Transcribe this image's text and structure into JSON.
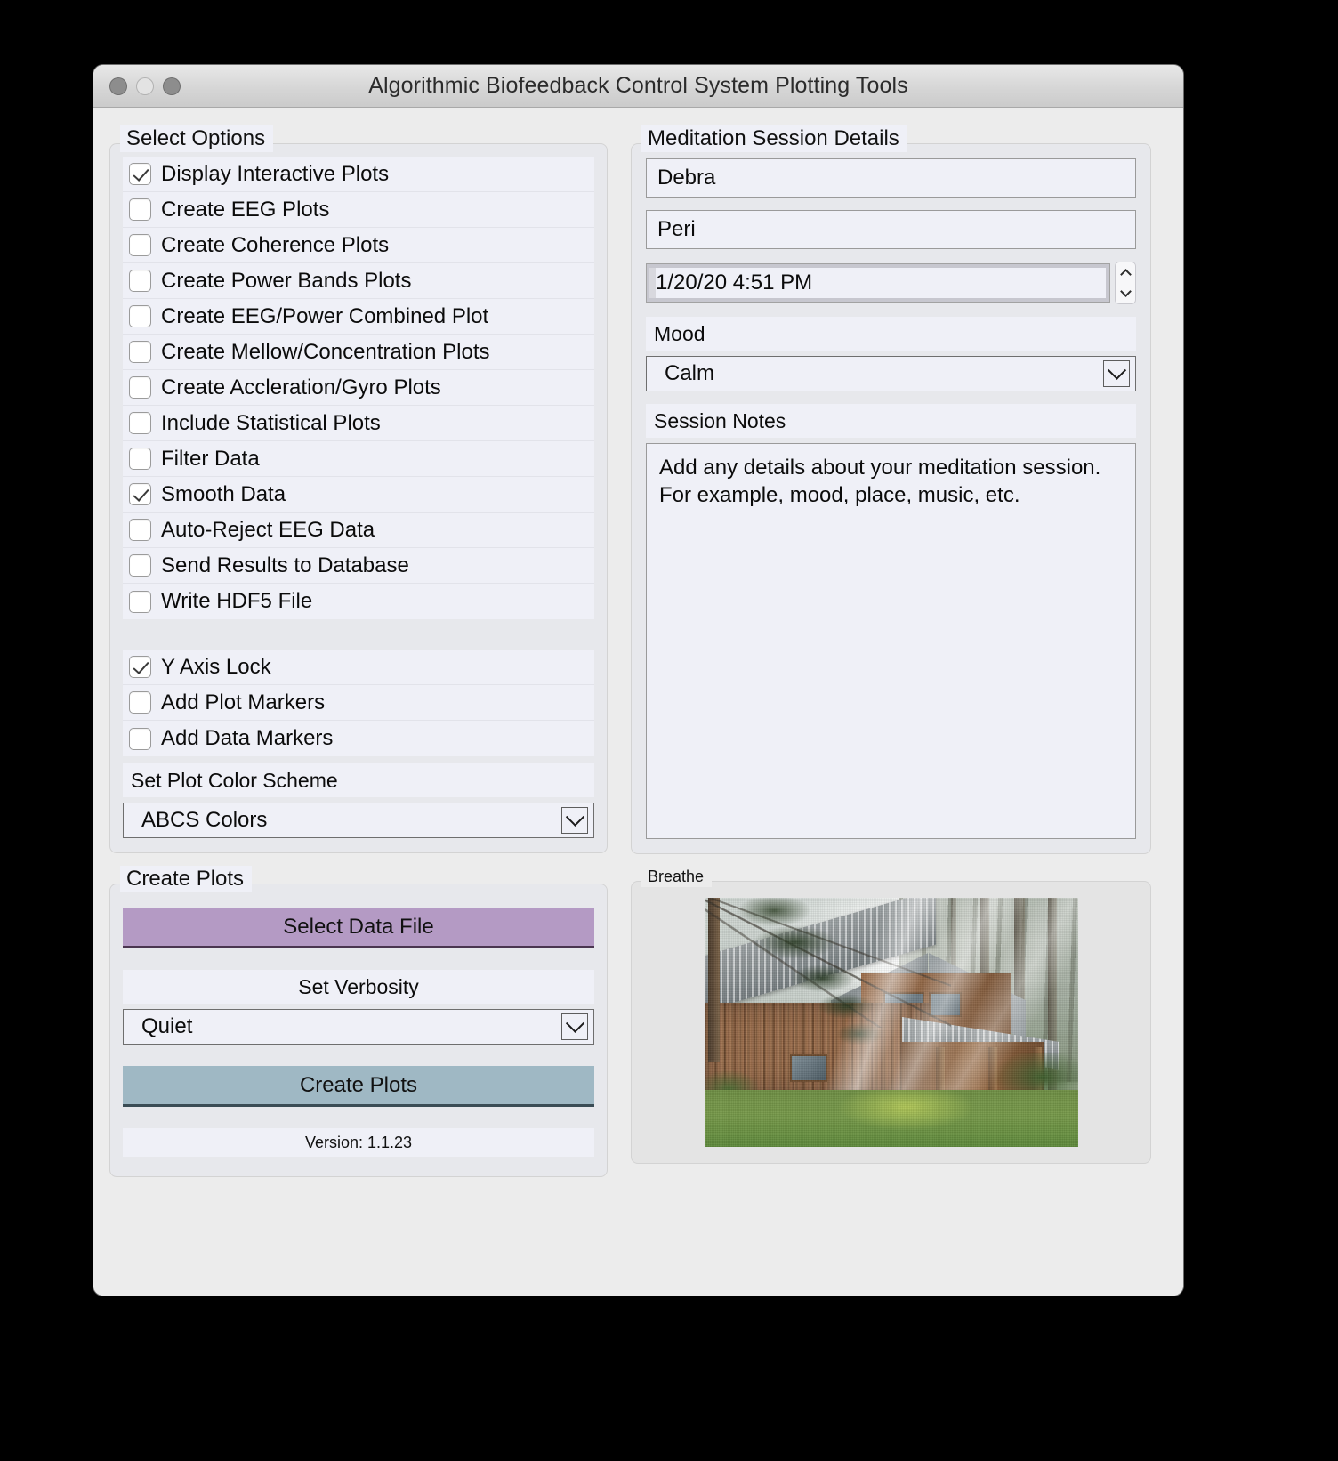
{
  "window": {
    "title": "Algorithmic Biofeedback Control System Plotting Tools",
    "traffic_lights": [
      "close",
      "minimize",
      "maximize"
    ]
  },
  "left": {
    "select_options": {
      "label": "Select Options",
      "checkboxes_group_1": [
        {
          "label": "Display Interactive Plots",
          "checked": true
        },
        {
          "label": "Create EEG Plots",
          "checked": false
        },
        {
          "label": "Create Coherence Plots",
          "checked": false
        },
        {
          "label": "Create Power Bands Plots",
          "checked": false
        },
        {
          "label": "Create EEG/Power Combined Plot",
          "checked": false
        },
        {
          "label": "Create Mellow/Concentration Plots",
          "checked": false
        },
        {
          "label": "Create Accleration/Gyro Plots",
          "checked": false
        },
        {
          "label": "Include Statistical Plots",
          "checked": false
        },
        {
          "label": "Filter Data",
          "checked": false
        },
        {
          "label": "Smooth Data",
          "checked": true
        },
        {
          "label": "Auto-Reject EEG Data",
          "checked": false
        },
        {
          "label": "Send Results to Database",
          "checked": false
        },
        {
          "label": "Write HDF5 File",
          "checked": false
        }
      ],
      "checkboxes_group_2": [
        {
          "label": "Y Axis Lock",
          "checked": true
        },
        {
          "label": "Add Plot Markers",
          "checked": false
        },
        {
          "label": "Add Data Markers",
          "checked": false
        }
      ],
      "color_scheme": {
        "label": "Set Plot Color Scheme",
        "selected": "ABCS Colors",
        "options": [
          "ABCS Colors"
        ]
      }
    },
    "create_plots": {
      "label": "Create Plots",
      "select_data_file_button": "Select Data File",
      "verbosity_label": "Set Verbosity",
      "verbosity_selected": "Quiet",
      "verbosity_options": [
        "Quiet"
      ],
      "create_plots_button": "Create Plots",
      "version": "Version: 1.1.23"
    }
  },
  "right": {
    "session_details": {
      "label": "Meditation Session Details",
      "first_name": "Debra",
      "last_name": "Peri",
      "datetime": "1/20/20 4:51 PM",
      "mood_label": "Mood",
      "mood_selected": "Calm",
      "mood_options": [
        "Calm"
      ],
      "notes_label": "Session Notes",
      "notes_placeholder": "Add any details about your meditation session.  For example, mood, place, music, etc."
    },
    "breathe": {
      "label": "Breathe",
      "image_alt": "wooden-cabin-in-misty-forest-with-sunbeams"
    }
  },
  "colors": {
    "select_data_file_button": "#b49ac4",
    "create_plots_button": "#9fb8c4",
    "window_chrome": "#ececec",
    "field_background": "#eff0f7"
  }
}
